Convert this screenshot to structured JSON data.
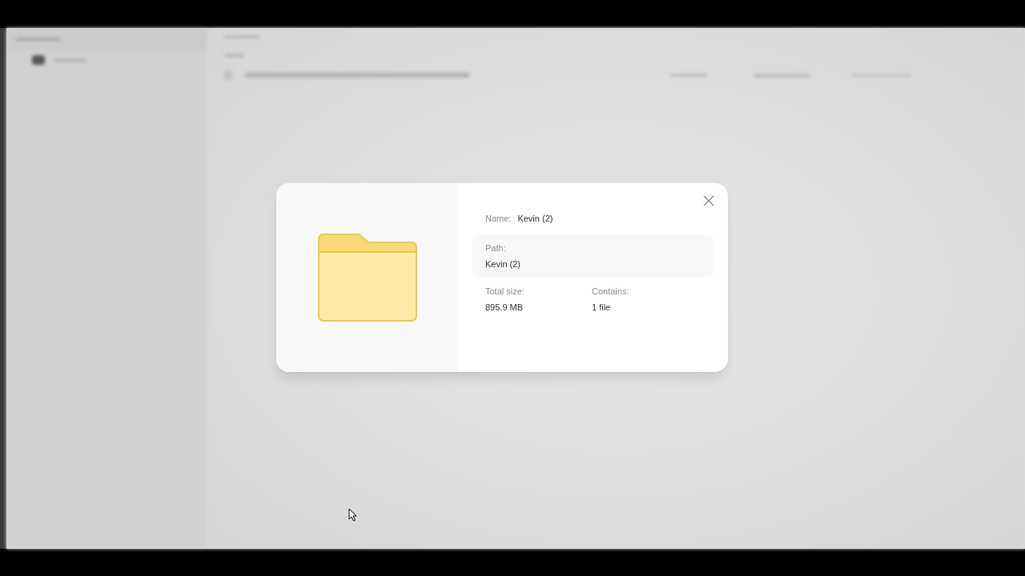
{
  "dialog": {
    "name_label": "Name:",
    "name_value": "Kevin (2)",
    "path_label": "Path:",
    "path_value": "Kevin (2)",
    "details": [
      {
        "label": "Total size:",
        "value": "895.9 MB"
      },
      {
        "label": "Contains:",
        "value": "1 file"
      }
    ]
  }
}
